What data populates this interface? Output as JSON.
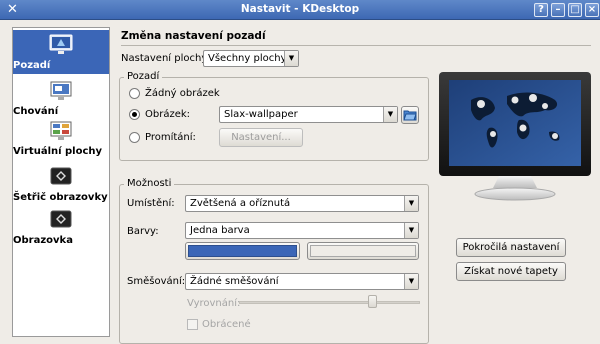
{
  "window": {
    "title": "Nastavit - KDesktop"
  },
  "sidebar": {
    "items": [
      {
        "label": "Pozadí",
        "icon": "desktop-background-icon",
        "selected": true
      },
      {
        "label": "Chování",
        "icon": "desktop-behavior-icon",
        "selected": false
      },
      {
        "label": "Virtuální plochy",
        "icon": "virtual-desktops-icon",
        "selected": false
      },
      {
        "label": "Šetřič obrazovky",
        "icon": "screensaver-icon",
        "selected": false
      },
      {
        "label": "Obrazovka",
        "icon": "display-icon",
        "selected": false
      }
    ]
  },
  "main": {
    "header": "Změna nastavení pozadí",
    "desktop_setting": {
      "label": "Nastavení plochy:",
      "value": "Všechny plochy"
    },
    "background_group": {
      "title": "Pozadí",
      "no_image": "Žádný obrázek",
      "image": "Obrázek:",
      "image_value": "Slax-wallpaper",
      "slideshow": "Promítání:",
      "slideshow_settings": "Nastavení...",
      "selected": "image"
    },
    "options_group": {
      "title": "Možnosti",
      "position_label": "Umístění:",
      "position_value": "Zvětšená a oříznutá",
      "colors_label": "Barvy:",
      "colors_value": "Jedna barva",
      "color1": "#3b66b7",
      "color2": "#efece7",
      "blending_label": "Směšování:",
      "blending_value": "Žádné směšování",
      "balance_label": "Vyrovnání:",
      "reverse_label": "Obrácené"
    },
    "advanced_button": "Pokročilá nastavení",
    "get_wallpapers_button": "Získat nové tapety"
  }
}
